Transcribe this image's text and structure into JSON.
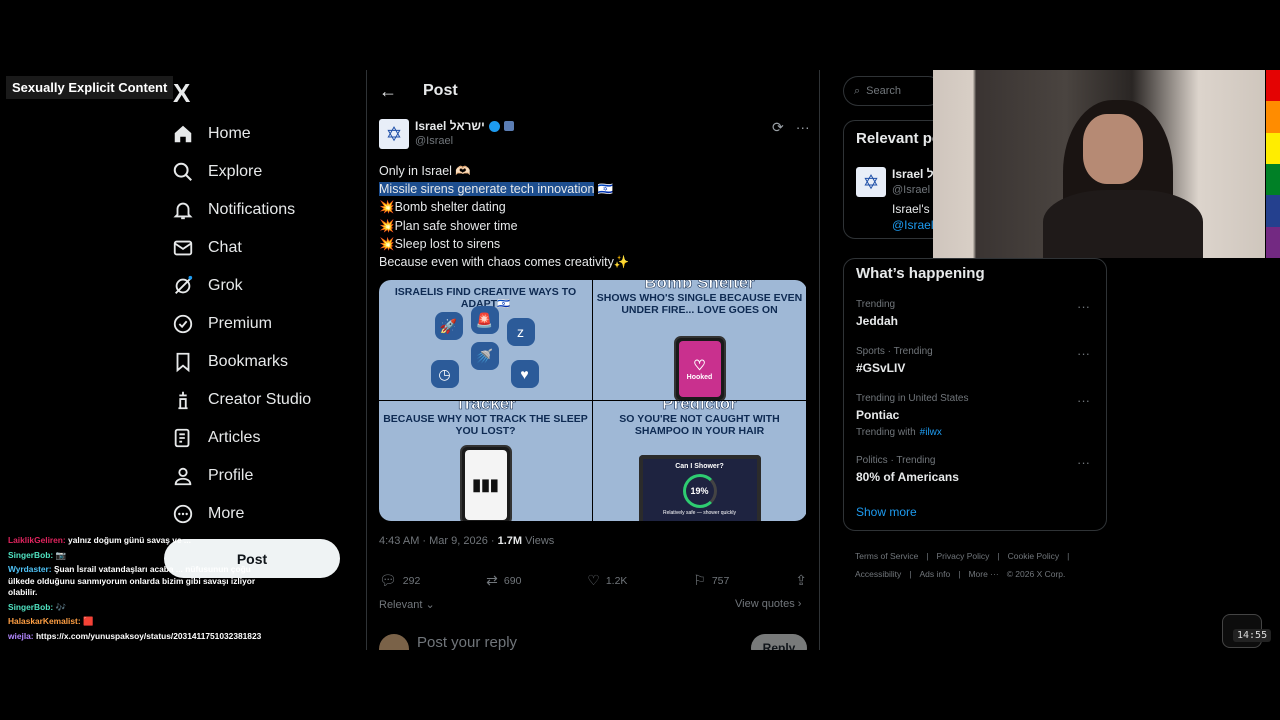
{
  "warning": "Sexually Explicit Content",
  "logo": "X",
  "nav": {
    "home": "Home",
    "explore": "Explore",
    "notifications": "Notifications",
    "chat": "Chat",
    "grok": "Grok",
    "premium": "Premium",
    "bookmarks": "Bookmarks",
    "creator": "Creator Studio",
    "articles": "Articles",
    "profile": "Profile",
    "more": "More",
    "post": "Post"
  },
  "chat": [
    {
      "user": "LaiklikGeliren:",
      "msg": "yalnız doğum günü savaş ve ..."
    },
    {
      "user": "SingerBob:",
      "msg": "📷"
    },
    {
      "user": "Wyrdaster:",
      "msg": "Şuan İsrail vatandaşları acaba ... nüfusunun çoğu ülkede olduğunu sanmıyorum onlarda bizim gibi savaşı izliyor olabilir."
    },
    {
      "user": "SingerBob:",
      "msg": "🎶"
    },
    {
      "user": "HalaskarKemalist:",
      "msg": "🟥"
    },
    {
      "user": "wiejla:",
      "msg": "https://x.com/yunuspaksoy/status/2031411751032381823"
    }
  ],
  "header": {
    "title": "Post"
  },
  "post": {
    "author_name": "Israel ישראל",
    "author_handle": "@Israel",
    "line1": "Only in Israel 🫶🏻",
    "line2": "Missile sirens generate tech innovation",
    "line2_flag": "🇮🇱",
    "line3": "💥Bomb shelter dating",
    "line4": "💥Plan safe shower time",
    "line5": "💥Sleep lost to sirens",
    "line6": "Because even with chaos comes creativity✨",
    "tile1_caption": "Israelis find creative ways to adapt🇮🇱",
    "tile2_big": "Bomb Shelter",
    "tile2_caption": "Shows who's single because even under fire... love goes on",
    "tile2_app": "Hooked",
    "tile3_big": "Tracker",
    "tile3_caption": "Because why not track the sleep you lost?",
    "tile4_big": "Predictor",
    "tile4_caption": "So you're not caught with shampoo in your hair",
    "tile4_screen_title": "Can I Shower?",
    "tile4_percent": "19%",
    "tile4_screen_sub": "Relatively safe — shower quickly",
    "time": "4:43 AM · Mar 9, 2026 · ",
    "views_count": "1.7M",
    "views_label": " Views",
    "replies": "292",
    "reposts": "690",
    "likes": "1.2K",
    "bookmarks": "757",
    "relevant": "Relevant",
    "view_quotes": "View quotes",
    "reply_placeholder": "Post your reply",
    "reply_button": "Reply"
  },
  "right": {
    "search_placeholder": "Search",
    "relevant_title": "Relevant people",
    "rel_name": "Israel ישראל",
    "rel_handle": "@Israel",
    "rel_bio": "Israel's official",
    "rel_link": "@IsraelMFA",
    "trending_title": "What’s happening",
    "trends": [
      {
        "context": "Trending",
        "topic": "Jeddah",
        "with_label": "",
        "with_tag": ""
      },
      {
        "context": "Sports · Trending",
        "topic": "#GSvLIV",
        "with_label": "",
        "with_tag": ""
      },
      {
        "context": "Trending in United States",
        "topic": "Pontiac",
        "with_label": "Trending with",
        "with_tag": "#ilwx"
      },
      {
        "context": "Politics · Trending",
        "topic": "80% of Americans",
        "with_label": "",
        "with_tag": ""
      }
    ],
    "show_more": "Show more",
    "footer": [
      "Terms of Service",
      "|",
      "Privacy Policy",
      "|",
      "Cookie Policy",
      "|",
      "Accessibility",
      "|",
      "Ads info",
      "|",
      "More ···",
      "© 2026 X Corp."
    ]
  },
  "timer": "14:55",
  "colors": {
    "accent": "#1d9bf0",
    "background": "#000000",
    "border": "#2f3336"
  }
}
